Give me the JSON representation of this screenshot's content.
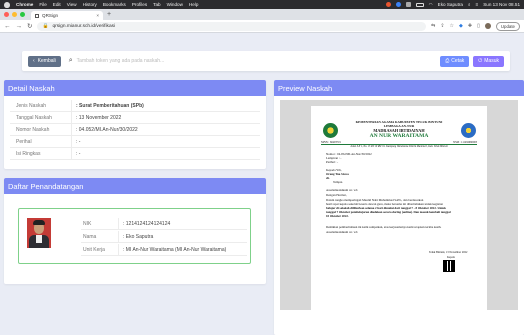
{
  "menubar": {
    "items": [
      "Chrome",
      "File",
      "Edit",
      "View",
      "History",
      "Bookmarks",
      "Profiles",
      "Tab",
      "Window",
      "Help"
    ],
    "user": "Eko Saputra",
    "clock": "Sun 13 Nov 08.51"
  },
  "browser": {
    "tab_title": "QRSign",
    "url": "qrsign.mianur.sch.id/verifikasi",
    "update_label": "Update"
  },
  "toolbar": {
    "back_label": "Kembali",
    "search_placeholder": "Tambah token yang ada pada naskah...",
    "cetak_label": "Cetak",
    "masuk_label": "Masuk"
  },
  "detail": {
    "title": "Detail Naskah",
    "rows": [
      {
        "label": "Jenis Naskah",
        "value": ": Surat Pemberitahuan (SPb)"
      },
      {
        "label": "Tanggal Naskah",
        "value": ": 13 November 2022"
      },
      {
        "label": "Nomor Naskah",
        "value": ": 04.052/MI.An-Nur/30/2022"
      },
      {
        "label": "Perihal",
        "value": ": -"
      },
      {
        "label": "Isi Ringkas",
        "value": ": -"
      }
    ]
  },
  "signature": {
    "title": "Daftar Penandatangan",
    "rows": [
      {
        "label": "NIK",
        "value": ": 1214124124124124"
      },
      {
        "label": "Nama",
        "value": ": Eko Saputra"
      },
      {
        "label": "Unit Kerja",
        "value": ": MI An-Nur Waraitama (MI An-Nur Waraitama)"
      }
    ]
  },
  "preview": {
    "title": "Preview Naskah",
    "doc": {
      "kop1": "KEMENTERIAN AGAMA KABUPATEN TELUK BINTUNI",
      "kop2": "LEMBAGA AN-NUR",
      "kop3": "MADRASAH IBTIDAIYAH",
      "kop4": "AN NUR WARAITAMA",
      "npsn": "NPSN : 60403719",
      "nsm": "NSM : 111292060003",
      "address": "Jalan S.P 1, No. 15 RT 10 RW 01. Kampung Waraitama Distrik Manimeri, Kab. Teluk Bintuni",
      "nomor": "Nomor     : 04.052/MI.An-Nur/30/2022",
      "lampiran": "Lampiran  : -",
      "perihal": "Perihal     : -",
      "kepada1": "Kepada Yth,",
      "kepada2": "Orang Tua Siswa",
      "kepada3": "di-",
      "kepada4": "Tempat.",
      "salam": "Assalamualaikum wr. wb",
      "hormat": "Dengan Hormat,",
      "body1": "Dalam rangka memperingati Maulid Nabi Muhammad SAW., dan berdasarkan",
      "body2": "hasil rapat kepala sekolah beserta dewan guru, maka bersama ini diberitahukan untuk kegiatan",
      "body3": "belajar di sekolah diliburkan selama 2 hari dimulai dari tanggal 7 - 8 Oktober 2022. Untuk",
      "body4": "tanggal 7 Oktober pembelajaran diadakan secara daring (online). Dan masuk kembali tanggal",
      "body5": "10 Oktober 2022.",
      "closing1": "Demikian pemberitahuan ini kami sampaikan, atas kerjasamanya kami ucapkan terima kasih.",
      "closing2": "Assalamualaikum wr. wb",
      "place": "Teluk Bintuni, 13 November 2022",
      "kepala": "Kepala"
    }
  },
  "colors": {
    "header": "#7d8af3",
    "back_btn": "#607088",
    "cetak_btn": "#6f8dff",
    "masuk_btn": "#8a76ff",
    "sig_border": "#7fd18a"
  }
}
